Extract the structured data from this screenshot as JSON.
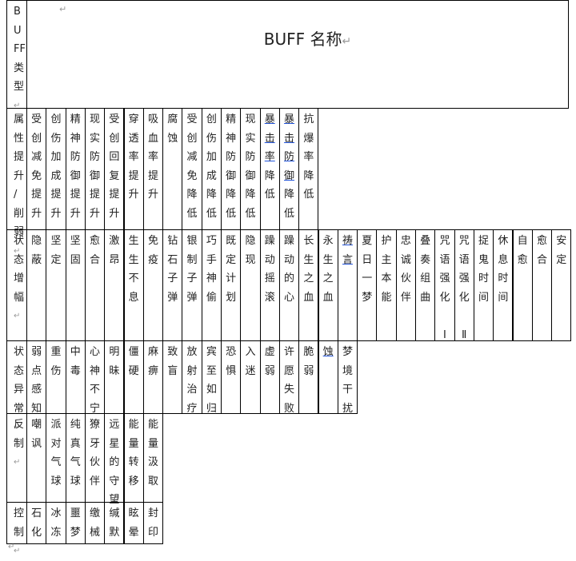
{
  "header": {
    "type_label": [
      "B",
      "U",
      "FF",
      "类",
      "型"
    ],
    "title": "BUFF 名称",
    "return_mark": "↵"
  },
  "rows": [
    {
      "label": [
        "属",
        "性",
        "提",
        "升",
        "/",
        "削",
        "弱"
      ],
      "cells": [
        {
          "chars": [
            "受",
            "创",
            "减",
            "免",
            "提",
            "升"
          ]
        },
        {
          "chars": [
            "创",
            "伤",
            "加",
            "成",
            "提",
            "升"
          ]
        },
        {
          "chars": [
            "精",
            "神",
            "防",
            "御",
            "提",
            "升"
          ]
        },
        {
          "chars": [
            "现",
            "实",
            "防",
            "御",
            "提",
            "升"
          ]
        },
        {
          "chars": [
            "受",
            "创",
            "回",
            "复",
            "提",
            "升"
          ]
        },
        {
          "chars": [
            "穿",
            "透",
            "率",
            "提",
            "升"
          ]
        },
        {
          "chars": [
            "吸",
            "血",
            "率",
            "提",
            "升"
          ]
        },
        {
          "chars": [
            "腐",
            "蚀"
          ]
        },
        {
          "chars": [
            "受",
            "创",
            "减",
            "免",
            "降",
            "低"
          ]
        },
        {
          "chars": [
            "创",
            "伤",
            "加",
            "成",
            "降",
            "低"
          ]
        },
        {
          "chars": [
            "精",
            "神",
            "防",
            "御",
            "降",
            "低"
          ]
        },
        {
          "chars": [
            "现",
            "实",
            "防",
            "御",
            "降",
            "低"
          ]
        },
        {
          "chars": [
            "暴",
            "击",
            "率",
            "降",
            "低"
          ],
          "underline": [
            0,
            1,
            2
          ]
        },
        {
          "chars": [
            "暴",
            "击",
            "防",
            "御",
            "降",
            "低"
          ],
          "underline": [
            0,
            1,
            2,
            3
          ]
        },
        {
          "chars": [
            "抗",
            "爆",
            "率",
            "降",
            "低"
          ]
        }
      ]
    },
    {
      "label": [
        "状",
        "态",
        "增",
        "幅"
      ],
      "cells": [
        {
          "chars": [
            "隐",
            "蔽"
          ]
        },
        {
          "chars": [
            "坚",
            "定"
          ]
        },
        {
          "chars": [
            "坚",
            "固"
          ]
        },
        {
          "chars": [
            "愈",
            "合"
          ]
        },
        {
          "chars": [
            "激",
            "昂"
          ]
        },
        {
          "chars": [
            "生",
            "生",
            "不",
            "息"
          ]
        },
        {
          "chars": [
            "免",
            "疫"
          ]
        },
        {
          "chars": [
            "钻",
            "石",
            "子",
            "弹"
          ]
        },
        {
          "chars": [
            "银",
            "制",
            "子",
            "弹"
          ]
        },
        {
          "chars": [
            "巧",
            "手",
            "神",
            "偷"
          ]
        },
        {
          "chars": [
            "既",
            "定",
            "计",
            "划"
          ]
        },
        {
          "chars": [
            "隐",
            "现"
          ]
        },
        {
          "chars": [
            "躁",
            "动",
            "摇",
            "滚"
          ]
        },
        {
          "chars": [
            "躁",
            "动",
            "的",
            "心"
          ]
        },
        {
          "chars": [
            "长",
            "生",
            "之",
            "血"
          ]
        },
        {
          "chars": [
            "永",
            "生",
            "之",
            "血"
          ]
        },
        {
          "chars": [
            "祷",
            "言"
          ],
          "underline": [
            0,
            1
          ]
        },
        {
          "chars": [
            "夏",
            "日",
            "一",
            "梦"
          ]
        },
        {
          "chars": [
            "护",
            "主",
            "本",
            "能"
          ]
        },
        {
          "chars": [
            "忠",
            "诚",
            "伙",
            "伴"
          ]
        },
        {
          "chars": [
            "叠",
            "奏",
            "组",
            "曲"
          ]
        },
        {
          "chars": [
            "咒",
            "语",
            "强",
            "化",
            "",
            "Ⅰ"
          ]
        },
        {
          "chars": [
            "咒",
            "语",
            "强",
            "化",
            "",
            "Ⅱ"
          ]
        },
        {
          "chars": [
            "捉",
            "鬼",
            "时",
            "间"
          ]
        },
        {
          "chars": [
            "休",
            "息",
            "时",
            "间"
          ]
        },
        {
          "chars": [
            "自",
            "愈"
          ]
        },
        {
          "chars": [
            "愈",
            "合"
          ]
        },
        {
          "chars": [
            "安",
            "定"
          ]
        }
      ]
    },
    {
      "label": [
        "状",
        "态",
        "异",
        "常"
      ],
      "cells": [
        {
          "chars": [
            "弱",
            "点",
            "感",
            "知"
          ]
        },
        {
          "chars": [
            "重",
            "伤"
          ]
        },
        {
          "chars": [
            "中",
            "毒"
          ]
        },
        {
          "chars": [
            "心",
            "神",
            "不",
            "宁"
          ]
        },
        {
          "chars": [
            "明",
            "昧"
          ]
        },
        {
          "chars": [
            "僵",
            "硬"
          ]
        },
        {
          "chars": [
            "麻",
            "痹"
          ]
        },
        {
          "chars": [
            "致",
            "盲"
          ]
        },
        {
          "chars": [
            "放",
            "射",
            "治",
            "疗"
          ]
        },
        {
          "chars": [
            "宾",
            "至",
            "如",
            "归"
          ]
        },
        {
          "chars": [
            "恐",
            "惧"
          ]
        },
        {
          "chars": [
            "入",
            "迷"
          ]
        },
        {
          "chars": [
            "虚",
            "弱"
          ]
        },
        {
          "chars": [
            "许",
            "愿",
            "失",
            "败"
          ]
        },
        {
          "chars": [
            "脆",
            "弱"
          ]
        },
        {
          "chars": [
            "蚀"
          ],
          "underline": [
            0
          ]
        },
        {
          "chars": [
            "梦",
            "境",
            "干",
            "扰"
          ]
        }
      ]
    },
    {
      "label": [
        "反",
        "制"
      ],
      "cells": [
        {
          "chars": [
            "嘲",
            "讽"
          ]
        },
        {
          "chars": [
            "派",
            "对",
            "气",
            "球"
          ]
        },
        {
          "chars": [
            "纯",
            "真",
            "气",
            "球"
          ]
        },
        {
          "chars": [
            "獠",
            "牙",
            "伙",
            "伴"
          ]
        },
        {
          "chars": [
            "远",
            "星",
            "的",
            "守",
            "望"
          ]
        },
        {
          "chars": [
            "能",
            "量",
            "转",
            "移"
          ]
        },
        {
          "chars": [
            "能",
            "量",
            "汲",
            "取"
          ]
        }
      ]
    },
    {
      "label": [
        "控",
        "制"
      ],
      "cells": [
        {
          "chars": [
            "石",
            "化"
          ]
        },
        {
          "chars": [
            "冰",
            "冻"
          ]
        },
        {
          "chars": [
            "噩",
            "梦"
          ]
        },
        {
          "chars": [
            "缴",
            "械"
          ]
        },
        {
          "chars": [
            "缄",
            "默"
          ]
        },
        {
          "chars": [
            "眩",
            "晕"
          ]
        },
        {
          "chars": [
            "封",
            "印"
          ]
        }
      ]
    }
  ]
}
